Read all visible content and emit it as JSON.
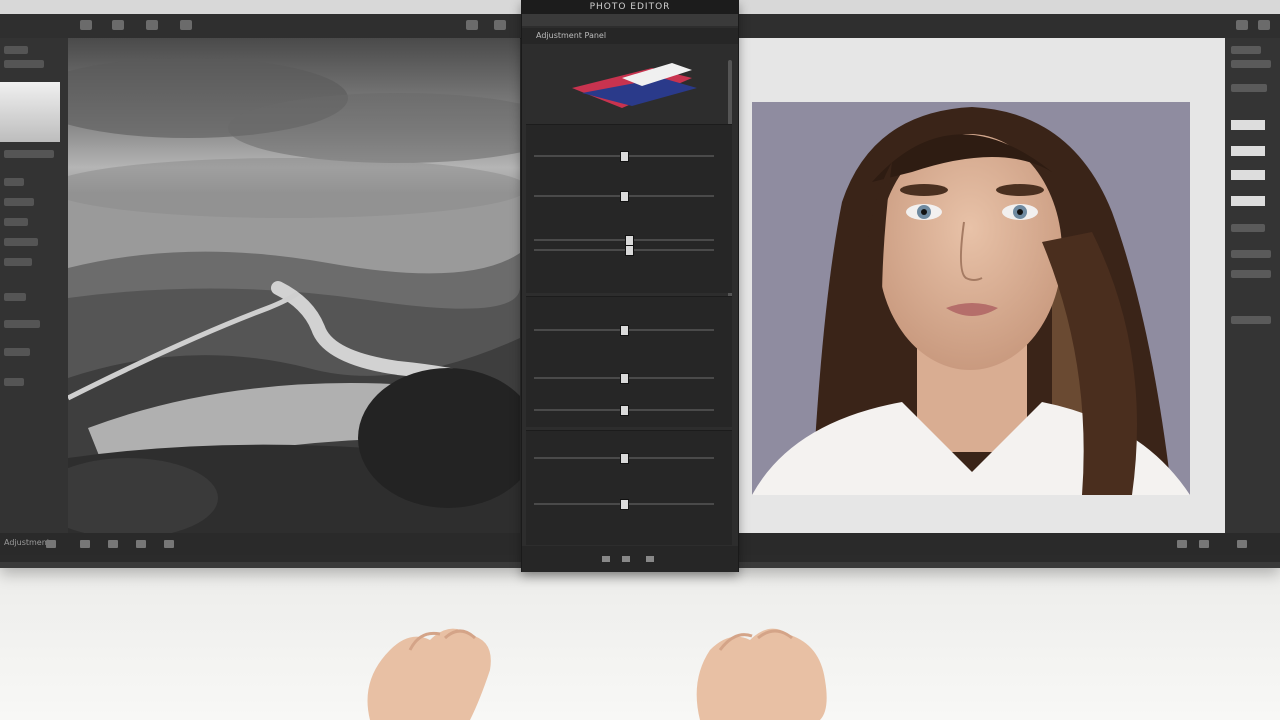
{
  "window": {
    "title": "PHOTO EDITOR"
  },
  "status": {
    "zoom_label": "Adjustment"
  },
  "adjustment_panel": {
    "header_label": "Adjustment Panel",
    "slider_positions": [
      0.5,
      0.5,
      0.53,
      0.53,
      0.5,
      0.5,
      0.5,
      0.5,
      0.5
    ]
  },
  "images": {
    "left": "landscape-photo",
    "right": "portrait-photo"
  },
  "colors": {
    "accent": "#c8334f",
    "panel": "#2d2d2d"
  }
}
